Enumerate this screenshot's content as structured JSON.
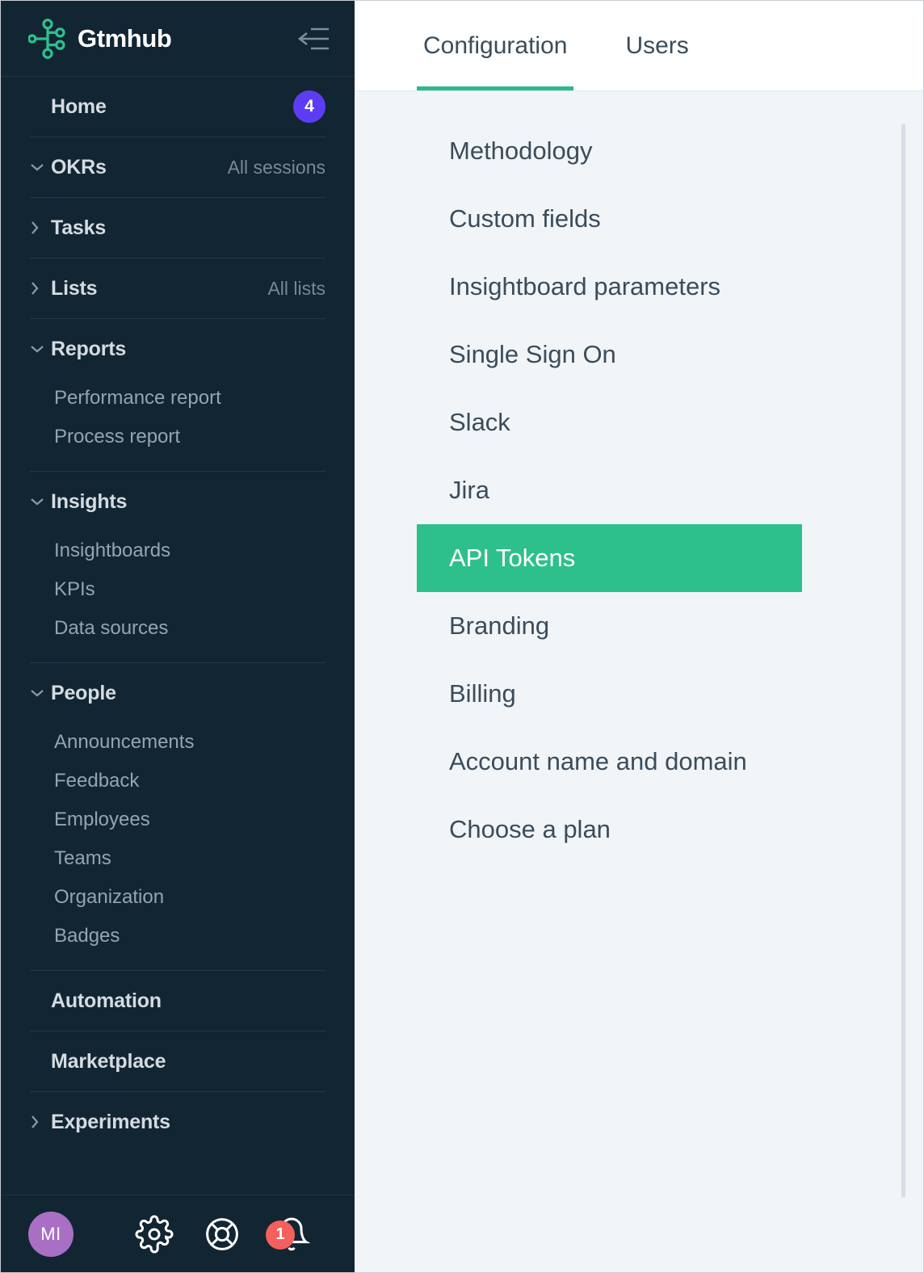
{
  "sidebar": {
    "brand": {
      "name": "Gtmhub",
      "logo_icon": "gtmhub-network-logo-icon",
      "accent_color": "#2EC08C"
    },
    "collapse_icon": "collapse-sidebar-icon",
    "groups": [
      {
        "title": "Home",
        "chevron": "none",
        "badge": "4",
        "badge_color": "#5D3DF4",
        "aside": "",
        "children": []
      },
      {
        "title": "OKRs",
        "chevron": "down",
        "badge": "",
        "aside": "All sessions",
        "children": []
      },
      {
        "title": "Tasks",
        "chevron": "right",
        "badge": "",
        "aside": "",
        "children": []
      },
      {
        "title": "Lists",
        "chevron": "right",
        "badge": "",
        "aside": "All lists",
        "children": []
      },
      {
        "title": "Reports",
        "chevron": "down",
        "badge": "",
        "aside": "",
        "children": [
          "Performance report",
          "Process report"
        ]
      },
      {
        "title": "Insights",
        "chevron": "down",
        "badge": "",
        "aside": "",
        "children": [
          "Insightboards",
          "KPIs",
          "Data sources"
        ]
      },
      {
        "title": "People",
        "chevron": "down",
        "badge": "",
        "aside": "",
        "children": [
          "Announcements",
          "Feedback",
          "Employees",
          "Teams",
          "Organization",
          "Badges"
        ]
      },
      {
        "title": "Automation",
        "chevron": "none",
        "badge": "",
        "aside": "",
        "children": []
      },
      {
        "title": "Marketplace",
        "chevron": "none",
        "badge": "",
        "aside": "",
        "children": []
      },
      {
        "title": "Experiments",
        "chevron": "right",
        "badge": "",
        "aside": "",
        "children": []
      }
    ],
    "footer": {
      "avatar_initials": "MI",
      "avatar_color": "#A96FC4",
      "settings_icon": "gear-icon",
      "help_icon": "lifebuoy-icon",
      "notifications_icon": "bell-icon",
      "notifications_count": "1",
      "notifications_badge_color": "#F4605D"
    }
  },
  "main": {
    "tabs": [
      {
        "label": "Configuration",
        "active": true
      },
      {
        "label": "Users",
        "active": false
      }
    ],
    "active_tab_indicator_color": "#2BB98B",
    "settings_items": [
      {
        "label": "Methodology",
        "selected": false
      },
      {
        "label": "Custom fields",
        "selected": false
      },
      {
        "label": "Insightboard parameters",
        "selected": false
      },
      {
        "label": "Single Sign On",
        "selected": false
      },
      {
        "label": "Slack",
        "selected": false
      },
      {
        "label": "Jira",
        "selected": false
      },
      {
        "label": "API Tokens",
        "selected": true
      },
      {
        "label": "Branding",
        "selected": false
      },
      {
        "label": "Billing",
        "selected": false
      },
      {
        "label": "Account name and domain",
        "selected": false
      },
      {
        "label": "Choose a plan",
        "selected": false
      }
    ],
    "selected_item_color": "#2EC08C",
    "background_color": "#F1F5F8"
  }
}
